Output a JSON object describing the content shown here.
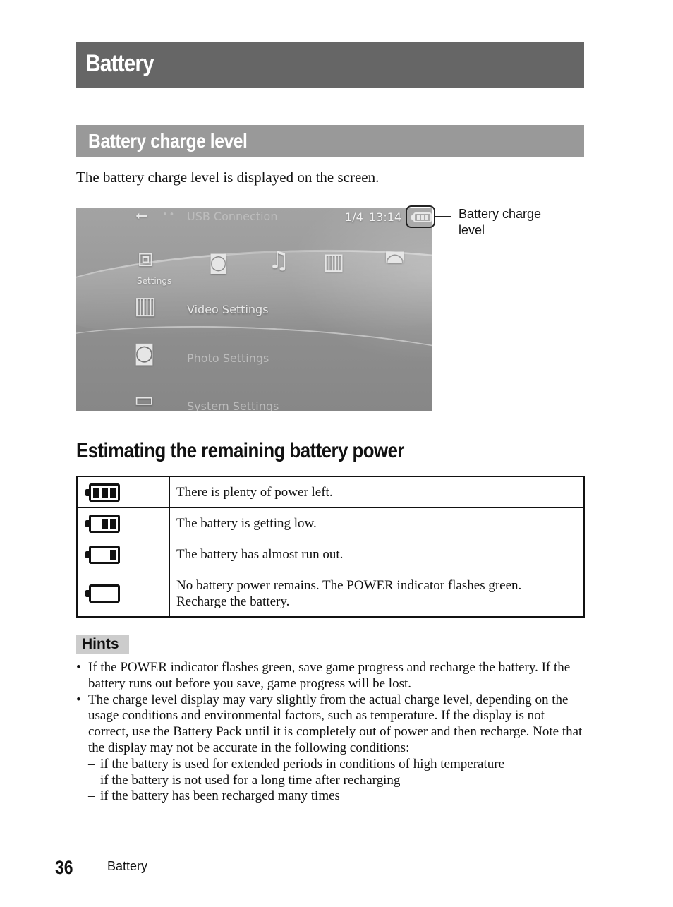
{
  "page": {
    "title": "Battery",
    "section_title": "Battery charge level",
    "intro": "The battery charge level is displayed on the screen.",
    "callout_label": "Battery charge level",
    "subsection_title": "Estimating the remaining battery power",
    "footer": {
      "page_number": "36",
      "section": "Battery"
    }
  },
  "psp_screen": {
    "status_label": "USB Connection",
    "date": "1/4",
    "time": "13:14",
    "battery_level_bars": 3,
    "categories": [
      {
        "icon": "toolbox-icon",
        "label": "Settings",
        "selected": true
      },
      {
        "icon": "camera-icon",
        "label": ""
      },
      {
        "icon": "music-note-icon",
        "label": ""
      },
      {
        "icon": "film-icon",
        "label": ""
      },
      {
        "icon": "gamepad-icon",
        "label": ""
      }
    ],
    "menu_items": [
      {
        "label": "Video Settings",
        "selected": true
      },
      {
        "label": "Photo Settings",
        "selected": false
      },
      {
        "label": "System Settings",
        "selected": false
      }
    ]
  },
  "battery_levels": [
    {
      "bars": 3,
      "description": "There is plenty of power left."
    },
    {
      "bars": 2,
      "description": "The battery is getting low."
    },
    {
      "bars": 1,
      "description": "The battery has almost run out."
    },
    {
      "bars": 0,
      "description": "No battery power remains. The POWER indicator flashes green.",
      "description_line2": "Recharge the battery."
    }
  ],
  "hints": {
    "label": "Hints",
    "items": [
      {
        "text": "If the POWER indicator flashes green, save game progress and recharge the battery. If the battery runs out before you save, game progress will be lost."
      },
      {
        "text": "The charge level display may vary slightly from the actual charge level, depending on the usage conditions and environmental factors, such as temperature. If the display is not correct, use the Battery Pack until it is completely out of power and then recharge. Note that the display may not be accurate in the following conditions:",
        "subitems": [
          "if the battery is used for extended periods in conditions of high temperature",
          "if the battery is not used for a long time after recharging",
          "if the battery has been recharged many times"
        ]
      }
    ]
  }
}
